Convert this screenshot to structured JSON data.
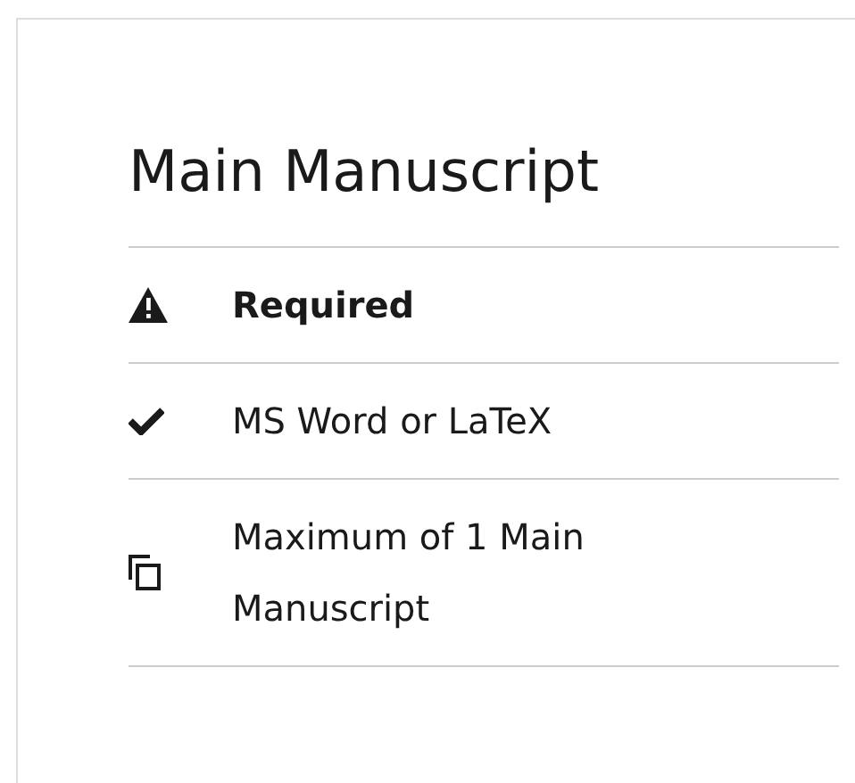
{
  "title": "Main Manuscript",
  "items": [
    {
      "kind": "warning",
      "text": "Required",
      "strong": true
    },
    {
      "kind": "check",
      "text": "MS Word or LaTeX",
      "strong": false
    },
    {
      "kind": "copies",
      "text": "Maximum of 1 Main Manuscript",
      "strong": false
    }
  ]
}
